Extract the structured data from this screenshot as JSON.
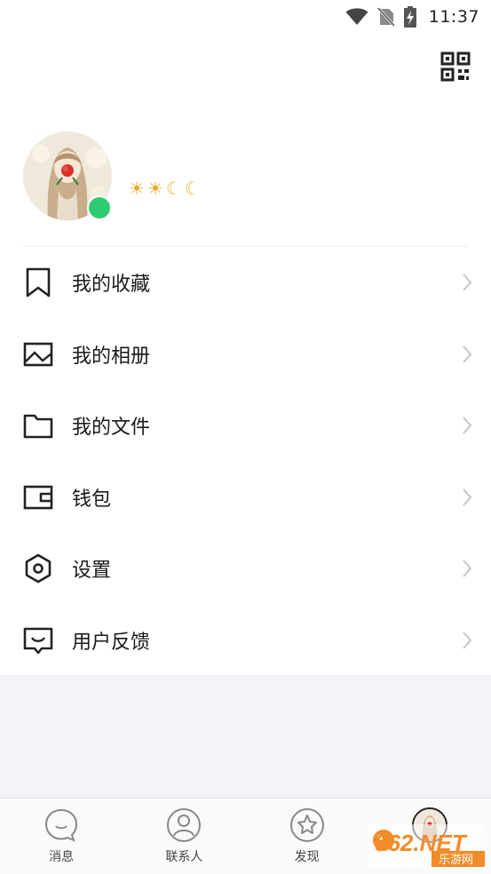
{
  "status": {
    "time": "11:37"
  },
  "menu": {
    "items": [
      {
        "label": "我的收藏",
        "icon": "bookmark-icon"
      },
      {
        "label": "我的相册",
        "icon": "picture-icon"
      },
      {
        "label": "我的文件",
        "icon": "folder-icon"
      },
      {
        "label": "钱包",
        "icon": "wallet-icon"
      },
      {
        "label": "设置",
        "icon": "hexagon-settings-icon"
      },
      {
        "label": "用户反馈",
        "icon": "feedback-icon"
      }
    ]
  },
  "level": {
    "icons": [
      "sun",
      "sun",
      "moon",
      "moon"
    ]
  },
  "tabs": [
    {
      "label": "消息",
      "icon": "chat-bubble-icon"
    },
    {
      "label": "联系人",
      "icon": "contact-icon"
    },
    {
      "label": "发现",
      "icon": "star-compass-icon"
    },
    {
      "label": "",
      "icon": "avatar"
    }
  ],
  "watermark": {
    "text": "962.NET",
    "subtext": "乐游网"
  },
  "colors": {
    "online": "#2ecc71",
    "background_gray": "#f3f4f8",
    "icon_stroke": "#222222"
  }
}
